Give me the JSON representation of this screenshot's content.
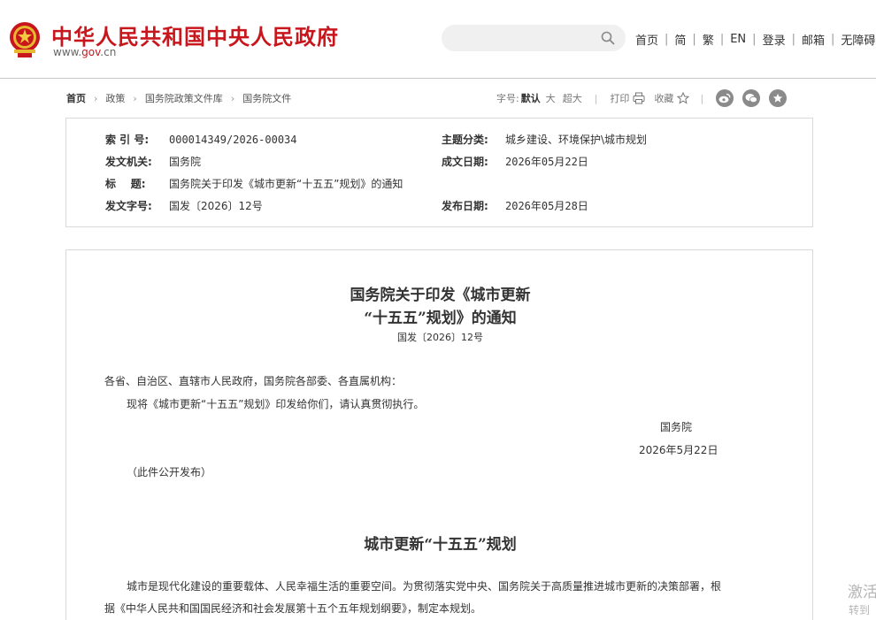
{
  "header": {
    "site_title": "中华人民共和国中央人民政府",
    "domain_prefix": "www.",
    "domain_gov": "gov",
    "domain_suffix": ".cn",
    "search_placeholder": "",
    "nav": [
      "首页",
      "简",
      "繁",
      "EN",
      "登录",
      "邮箱",
      "无障碍"
    ]
  },
  "breadcrumb": [
    "首页",
    "政策",
    "国务院政策文件库",
    "国务院文件"
  ],
  "tools": {
    "font_label": "字号:",
    "font_default": "默认",
    "font_large": "大",
    "font_xlarge": "超大",
    "print": "打印",
    "favorite": "收藏"
  },
  "meta": {
    "index_no_label": "索 引 号:",
    "index_no": "000014349/2026-00034",
    "issuer_label": "发文机关:",
    "issuer": "国务院",
    "title_label": "标    题:",
    "title": "国务院关于印发《城市更新“十五五”规划》的通知",
    "doc_no_label": "发文字号:",
    "doc_no": "国发〔2026〕12号",
    "subject_label": "主题分类:",
    "subject": "城乡建设、环境保护\\城市规划",
    "written_label": "成文日期:",
    "written_date": "2026年05月22日",
    "publish_label": "发布日期:",
    "publish_date": "2026年05月28日"
  },
  "document": {
    "title_line1": "国务院关于印发《城市更新",
    "title_line2": "“十五五”规划》的通知",
    "doc_number": "国发〔2026〕12号",
    "salutation": "各省、自治区、直辖市人民政府，国务院各部委、各直属机构：",
    "body": "现将《城市更新“十五五”规划》印发给你们，请认真贯彻执行。",
    "signature": "国务院",
    "sign_date": "2026年5月22日",
    "public_note": "（此件公开发布）",
    "plan_title": "城市更新“十五五”规划",
    "plan_para_line1": "城市是现代化建设的重要载体、人民幸福生活的重要空间。为贯彻落实党中央、国务院关于高质量推进城市更新的决策部署，根",
    "plan_para_line2": "据《中华人民共和国国民经济和社会发展第十五个五年规划纲要》，制定本规划。"
  },
  "watermark": {
    "line1": "激活",
    "line2": "转到"
  },
  "colors": {
    "brand_red": "#c8161d",
    "share_grey": "#8a8a8a"
  }
}
